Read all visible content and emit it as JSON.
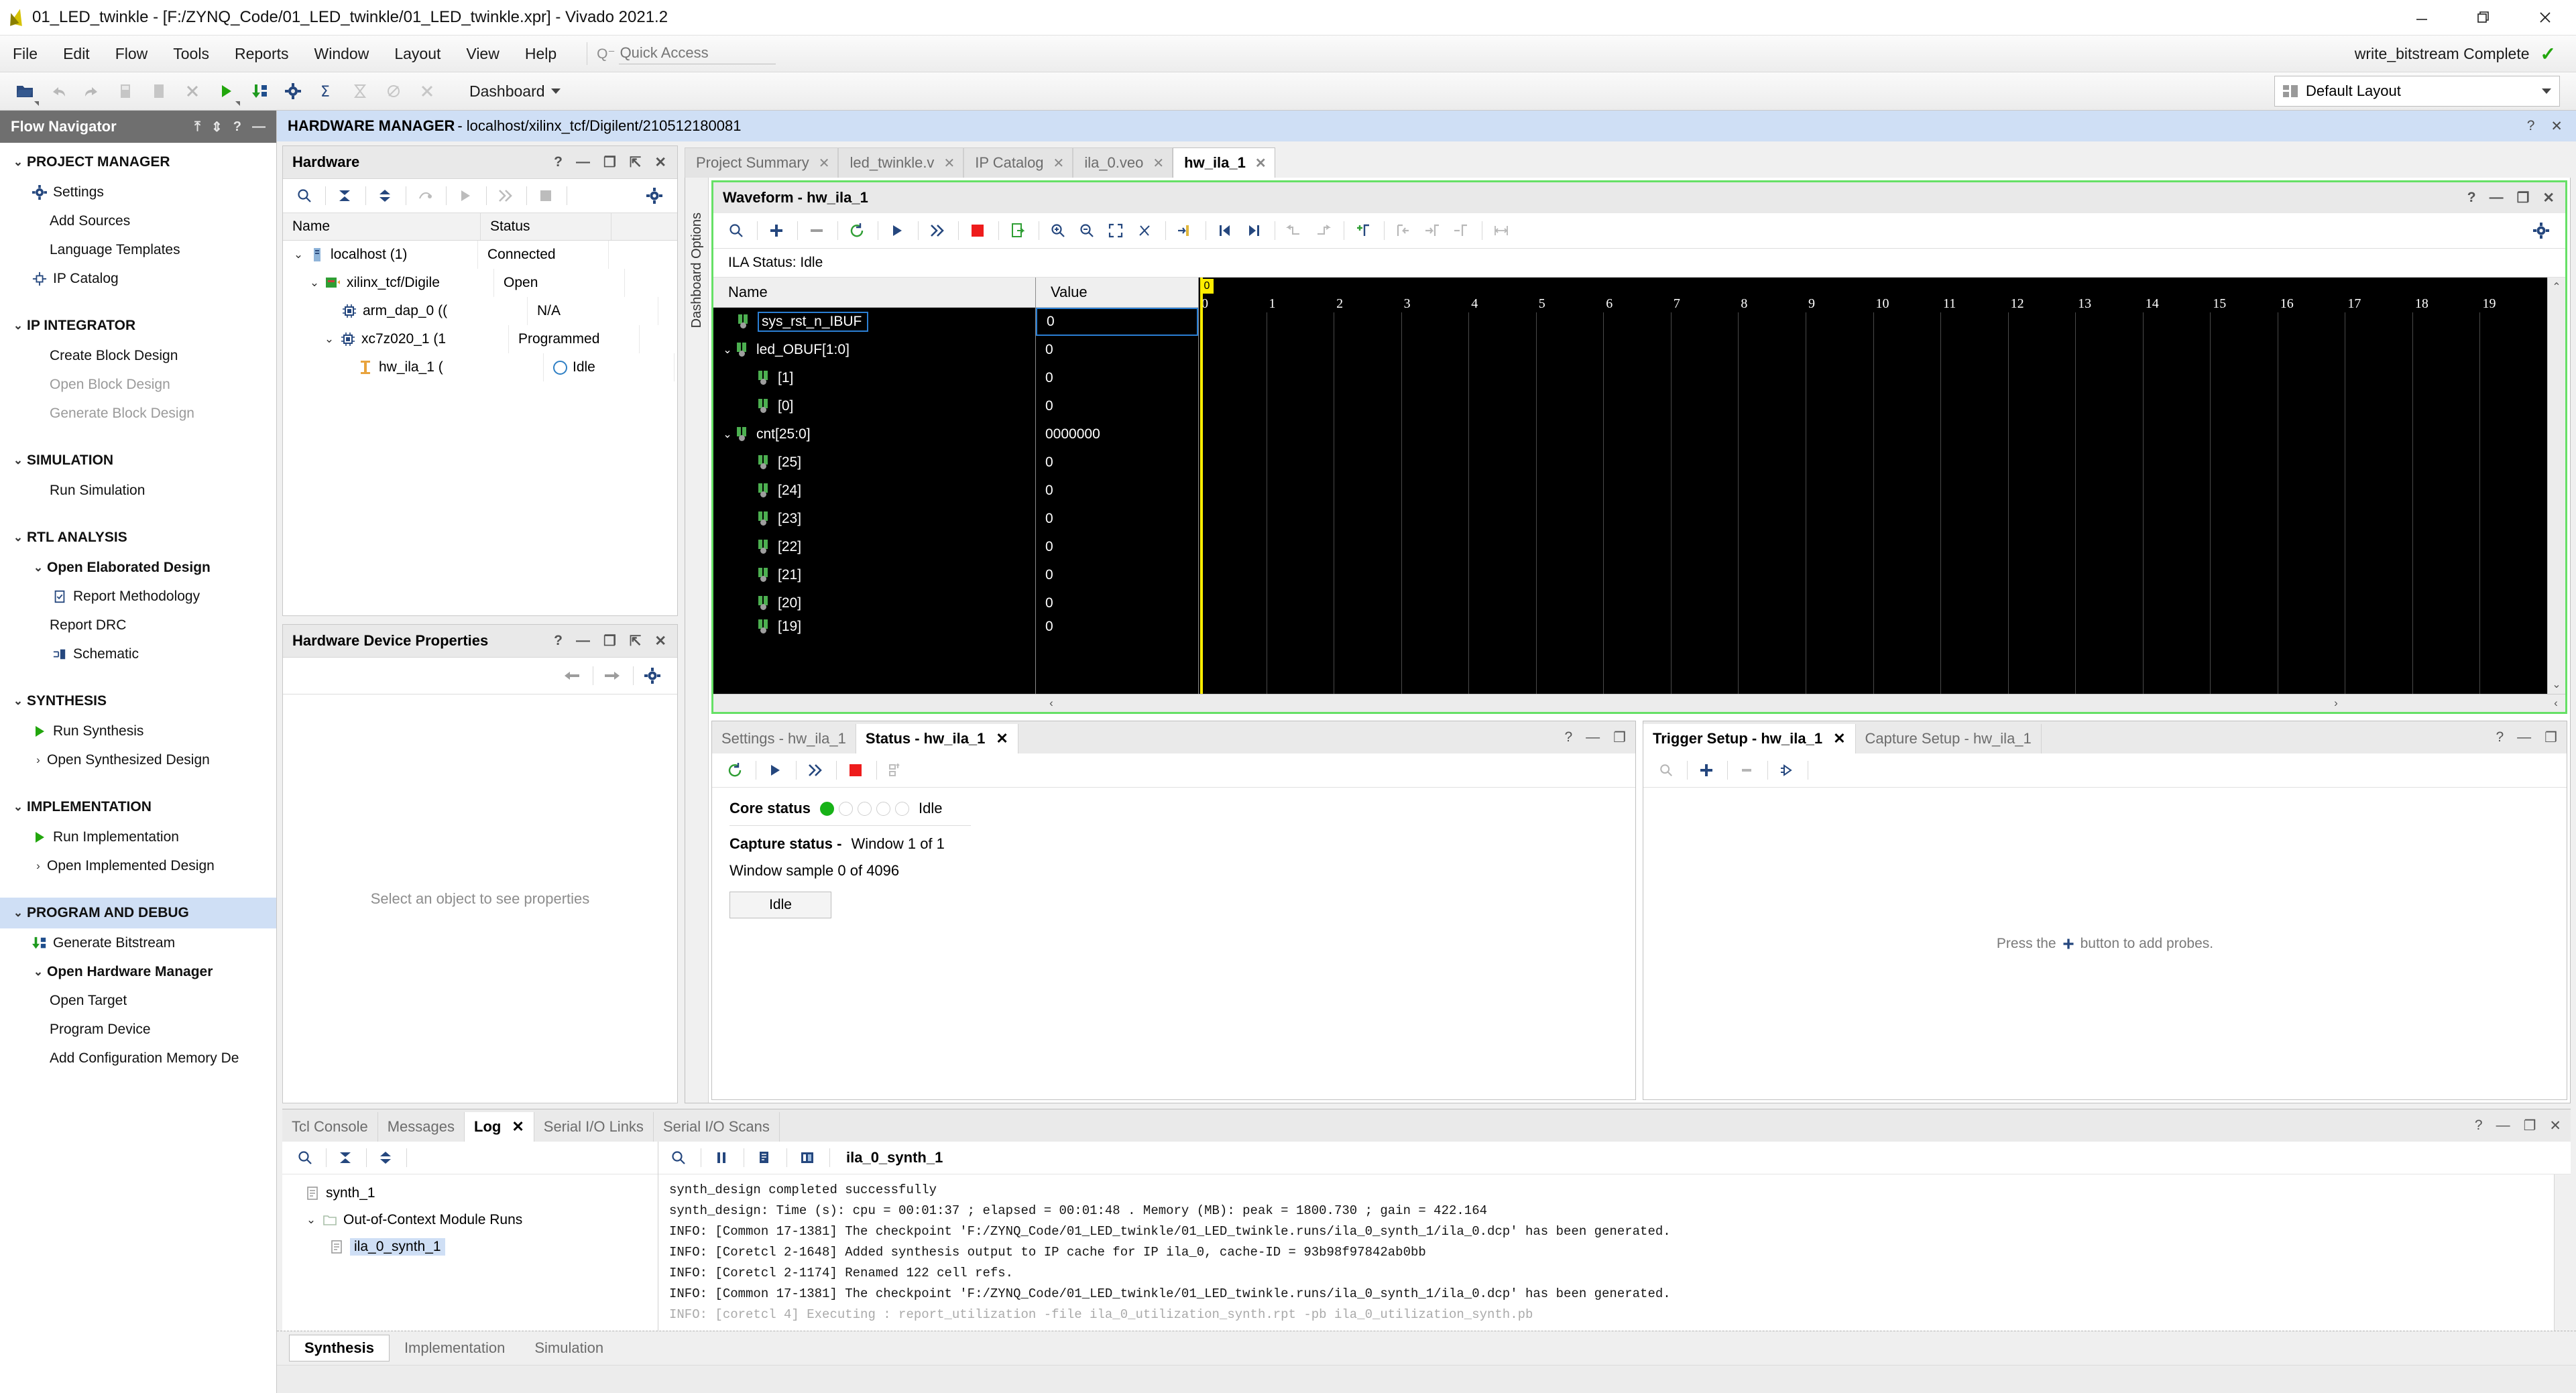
{
  "window": {
    "title": "01_LED_twinkle - [F:/ZYNQ_Code/01_LED_twinkle/01_LED_twinkle.xpr] - Vivado 2021.2",
    "minimize": "–",
    "restore": "❐",
    "close": "✕"
  },
  "menubar": {
    "items": [
      "File",
      "Edit",
      "Flow",
      "Tools",
      "Reports",
      "Window",
      "Layout",
      "View",
      "Help"
    ],
    "quick_access_placeholder": "Quick Access",
    "quick_access_value": "",
    "status_text": "write_bitstream Complete",
    "status_check": "✓"
  },
  "toolbar": {
    "dashboard_label": "Dashboard",
    "layout_value": "Default Layout",
    "icons": [
      "open-project-icon",
      "undo-icon",
      "redo-icon",
      "save-icon",
      "copy-icon",
      "close-x-icon",
      "run-icon",
      "generate-bitstream-icon",
      "settings-gear-icon",
      "sigma-icon",
      "timing-icon",
      "power-icon",
      "drc-icon"
    ]
  },
  "flow_navigator": {
    "title": "Flow Navigator",
    "header_icons": [
      "collapse-all-icon",
      "expand-all-icon",
      "help-icon",
      "minimize-icon"
    ],
    "groups": [
      {
        "label": "PROJECT MANAGER",
        "selected": false,
        "items": [
          {
            "label": "Settings",
            "icon": "gear-icon",
            "dim": false,
            "bold": false
          },
          {
            "label": "Add Sources",
            "icon": "",
            "dim": false,
            "bold": false
          },
          {
            "label": "Language Templates",
            "icon": "",
            "dim": false,
            "bold": false
          },
          {
            "label": "IP Catalog",
            "icon": "ip-catalog-icon",
            "dim": false,
            "bold": false
          }
        ]
      },
      {
        "label": "IP INTEGRATOR",
        "selected": false,
        "items": [
          {
            "label": "Create Block Design",
            "icon": "",
            "dim": false,
            "bold": false
          },
          {
            "label": "Open Block Design",
            "icon": "",
            "dim": true,
            "bold": false
          },
          {
            "label": "Generate Block Design",
            "icon": "",
            "dim": true,
            "bold": false
          }
        ]
      },
      {
        "label": "SIMULATION",
        "selected": false,
        "items": [
          {
            "label": "Run Simulation",
            "icon": "",
            "dim": false,
            "bold": false
          }
        ]
      },
      {
        "label": "RTL ANALYSIS",
        "selected": false,
        "items": [
          {
            "label": "Open Elaborated Design",
            "icon": "chevron-down-icon",
            "dim": false,
            "bold": true
          },
          {
            "label": "Report Methodology",
            "icon": "report-icon",
            "dim": false,
            "bold": false
          },
          {
            "label": "Report DRC",
            "icon": "",
            "dim": false,
            "bold": false
          },
          {
            "label": "Schematic",
            "icon": "schematic-icon",
            "dim": false,
            "bold": false
          }
        ]
      },
      {
        "label": "SYNTHESIS",
        "selected": false,
        "items": [
          {
            "label": "Run Synthesis",
            "icon": "run-green-icon",
            "dim": false,
            "bold": false
          },
          {
            "label": "Open Synthesized Design",
            "icon": "chevron-right-icon",
            "dim": false,
            "bold": false
          }
        ]
      },
      {
        "label": "IMPLEMENTATION",
        "selected": false,
        "items": [
          {
            "label": "Run Implementation",
            "icon": "run-green-icon",
            "dim": false,
            "bold": false
          },
          {
            "label": "Open Implemented Design",
            "icon": "chevron-right-icon",
            "dim": false,
            "bold": false
          }
        ]
      },
      {
        "label": "PROGRAM AND DEBUG",
        "selected": true,
        "items": [
          {
            "label": "Generate Bitstream",
            "icon": "generate-bitstream-icon",
            "dim": false,
            "bold": false
          },
          {
            "label": "Open Hardware Manager",
            "icon": "chevron-down-icon",
            "dim": false,
            "bold": true
          },
          {
            "label": "Open Target",
            "icon": "",
            "dim": false,
            "bold": false
          },
          {
            "label": "Program Device",
            "icon": "",
            "dim": false,
            "bold": false
          },
          {
            "label": "Add Configuration Memory De",
            "icon": "",
            "dim": false,
            "bold": false
          }
        ]
      }
    ]
  },
  "hardware_manager_bar": {
    "title": "HARDWARE MANAGER",
    "subtitle": "- localhost/xilinx_tcf/Digilent/210512180081"
  },
  "hardware_panel": {
    "title": "Hardware",
    "columns": [
      "Name",
      "Status"
    ],
    "rows": [
      {
        "name": "localhost (1)",
        "status": "Connected",
        "indent": 0,
        "chevron": "v",
        "icon": "server-icon",
        "status_icon": ""
      },
      {
        "name": "xilinx_tcf/Digile",
        "status": "Open",
        "indent": 1,
        "chevron": "v",
        "icon": "board-icon",
        "status_icon": ""
      },
      {
        "name": "arm_dap_0 ((",
        "status": "N/A",
        "indent": 2,
        "chevron": "",
        "icon": "chip-icon",
        "status_icon": ""
      },
      {
        "name": "xc7z020_1 (1",
        "status": "Programmed",
        "indent": 2,
        "chevron": "v",
        "icon": "chip-icon",
        "status_icon": ""
      },
      {
        "name": "hw_ila_1 (",
        "status": "Idle",
        "indent": 3,
        "chevron": "",
        "icon": "ila-icon",
        "status_icon": "circle-idle-icon"
      }
    ]
  },
  "hardware_properties": {
    "title": "Hardware Device Properties",
    "empty_text": "Select an object to see properties"
  },
  "document_tabs": [
    {
      "label": "Project Summary",
      "active": false,
      "closable": true
    },
    {
      "label": "led_twinkle.v",
      "active": false,
      "closable": true
    },
    {
      "label": "IP Catalog",
      "active": false,
      "closable": true
    },
    {
      "label": "ila_0.veo",
      "active": false,
      "closable": true
    },
    {
      "label": "hw_ila_1",
      "active": true,
      "closable": true
    }
  ],
  "vertical_strip": "Dashboard Options",
  "waveform": {
    "title": "Waveform - hw_ila_1",
    "ila_status": "ILA Status: Idle",
    "columns": [
      "Name",
      "Value"
    ],
    "signals": [
      {
        "name": "sys_rst_n_IBUF",
        "value": "0",
        "indent": 0,
        "chevron": "",
        "selected": true
      },
      {
        "name": "led_OBUF[1:0]",
        "value": "0",
        "indent": 0,
        "chevron": "v",
        "selected": false
      },
      {
        "name": "[1]",
        "value": "0",
        "indent": 1,
        "chevron": "",
        "selected": false
      },
      {
        "name": "[0]",
        "value": "0",
        "indent": 1,
        "chevron": "",
        "selected": false
      },
      {
        "name": "cnt[25:0]",
        "value": "0000000",
        "indent": 0,
        "chevron": "v",
        "selected": false
      },
      {
        "name": "[25]",
        "value": "0",
        "indent": 1,
        "chevron": "",
        "selected": false
      },
      {
        "name": "[24]",
        "value": "0",
        "indent": 1,
        "chevron": "",
        "selected": false
      },
      {
        "name": "[23]",
        "value": "0",
        "indent": 1,
        "chevron": "",
        "selected": false
      },
      {
        "name": "[22]",
        "value": "0",
        "indent": 1,
        "chevron": "",
        "selected": false
      },
      {
        "name": "[21]",
        "value": "0",
        "indent": 1,
        "chevron": "",
        "selected": false
      },
      {
        "name": "[20]",
        "value": "0",
        "indent": 1,
        "chevron": "",
        "selected": false
      },
      {
        "name": "[19]",
        "value": "0",
        "indent": 1,
        "chevron": "",
        "selected": false
      }
    ],
    "ruler_ticks": [
      "0",
      "1",
      "2",
      "3",
      "4",
      "5",
      "6",
      "7",
      "8",
      "9",
      "10",
      "11",
      "12",
      "13",
      "14",
      "15",
      "16",
      "17",
      "18",
      "19"
    ],
    "cursor_label": "0",
    "toolbar_icons": [
      "search-icon",
      "add-probe-icon",
      "remove-probe-icon",
      "refresh-icon",
      "run-trigger-icon",
      "run-trigger-immediate-icon",
      "stop-icon",
      "export-icon",
      "zoom-in-icon",
      "zoom-out-icon",
      "zoom-fit-icon",
      "zoom-no-icon",
      "goto-trigger-icon",
      "prev-marker-icon",
      "next-marker-icon",
      "prev-transition-icon",
      "next-transition-icon",
      "add-marker-icon",
      "first-marker-icon",
      "goto-marker-icon",
      "remove-marker-icon",
      "measure-icon"
    ]
  },
  "status_dock": {
    "tabs": [
      {
        "label": "Settings - hw_ila_1",
        "active": false,
        "closable": false
      },
      {
        "label": "Status - hw_ila_1",
        "active": true,
        "closable": true
      }
    ],
    "core_status_label": "Core status",
    "core_status_value": "Idle",
    "core_leds_on": 1,
    "core_leds_total": 5,
    "capture_status_label": "Capture status -",
    "capture_status_value": "Window 1 of 1",
    "window_sample": "Window sample 0 of 4096",
    "idle_button": "Idle",
    "toolbar_icons": [
      "refresh-icon",
      "run-trigger-icon",
      "run-trigger-immediate-icon",
      "stop-icon",
      "arm-icon"
    ]
  },
  "trigger_dock": {
    "tabs": [
      {
        "label": "Trigger Setup - hw_ila_1",
        "active": true,
        "closable": true
      },
      {
        "label": "Capture Setup - hw_ila_1",
        "active": false,
        "closable": false
      }
    ],
    "empty_prefix": "Press the",
    "empty_suffix": "button to add probes.",
    "toolbar_icons": [
      "search-icon",
      "add-icon",
      "remove-icon",
      "probe-icon"
    ]
  },
  "console": {
    "tabs": [
      {
        "label": "Tcl Console",
        "active": false,
        "closable": false
      },
      {
        "label": "Messages",
        "active": false,
        "closable": false
      },
      {
        "label": "Log",
        "active": true,
        "closable": true
      },
      {
        "label": "Serial I/O Links",
        "active": false,
        "closable": false
      },
      {
        "label": "Serial I/O Scans",
        "active": false,
        "closable": false
      }
    ],
    "runs": [
      {
        "label": "synth_1",
        "indent": 0,
        "chevron": "",
        "icon": "run-file-icon",
        "selected": false
      },
      {
        "label": "Out-of-Context Module Runs",
        "indent": 0,
        "chevron": "v",
        "icon": "folder-icon",
        "selected": false
      },
      {
        "label": "ila_0_synth_1",
        "indent": 1,
        "chevron": "",
        "icon": "run-file-icon",
        "selected": true
      }
    ],
    "active_run": "ila_0_synth_1",
    "left_toolbar_icons": [
      "search-icon",
      "collapse-all-icon",
      "expand-all-icon"
    ],
    "right_toolbar_icons": [
      "search-icon",
      "pause-icon",
      "copy-icon",
      "columns-icon"
    ],
    "log_lines": [
      "synth_design completed successfully",
      "synth_design: Time (s): cpu = 00:01:37 ; elapsed = 00:01:48 . Memory (MB): peak = 1800.730 ; gain = 422.164",
      "INFO: [Common 17-1381] The checkpoint 'F:/ZYNQ_Code/01_LED_twinkle/01_LED_twinkle.runs/ila_0_synth_1/ila_0.dcp' has been generated.",
      "INFO: [Coretcl 2-1648] Added synthesis output to IP cache for IP ila_0, cache-ID = 93b98f97842ab0bb",
      "INFO: [Coretcl 2-1174] Renamed 122 cell refs.",
      "INFO: [Common 17-1381] The checkpoint 'F:/ZYNQ_Code/01_LED_twinkle/01_LED_twinkle.runs/ila_0_synth_1/ila_0.dcp' has been generated.",
      "INFO: [coretcl 4] Executing : report_utilization -file ila_0_utilization_synth.rpt -pb ila_0_utilization_synth.pb"
    ]
  },
  "statusbar": {
    "tabs": [
      "Synthesis",
      "Implementation",
      "Simulation"
    ],
    "active_tab": "Synthesis"
  }
}
